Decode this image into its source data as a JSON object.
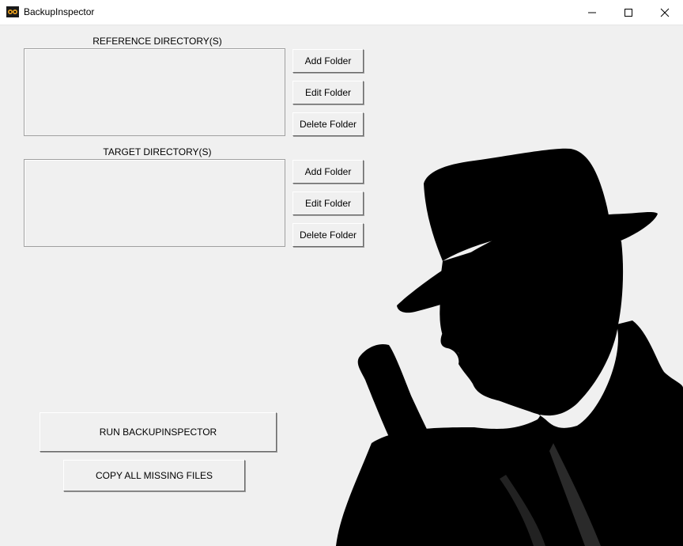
{
  "window": {
    "title": "BackupInspector",
    "controls": [
      "minimize-icon",
      "maximize-icon",
      "close-icon"
    ]
  },
  "reference": {
    "label": "REFERENCE DIRECTORY(S)",
    "folders": [],
    "add_label": "Add Folder",
    "edit_label": "Edit Folder",
    "delete_label": "Delete Folder"
  },
  "target": {
    "label": "TARGET DIRECTORY(S)",
    "folders": [],
    "add_label": "Add Folder",
    "edit_label": "Edit Folder",
    "delete_label": "Delete Folder"
  },
  "actions": {
    "run_label": "RUN BACKUPINSPECTOR",
    "copy_label": "COPY ALL MISSING FILES"
  },
  "colors": {
    "background": "#f0f0f0",
    "silhouette": "#000000"
  },
  "decor": {
    "image": "detective-with-pistol-silhouette"
  }
}
